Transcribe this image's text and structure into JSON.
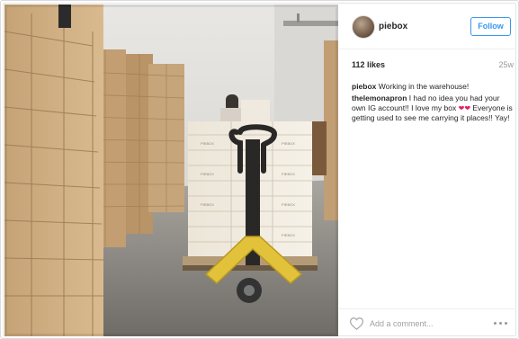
{
  "post": {
    "username": "piebox",
    "follow_label": "Follow",
    "likes": "112 likes",
    "time_ago": "25w",
    "caption_user": "piebox",
    "caption_text": "Working in the warehouse!",
    "comments": [
      {
        "user": "thelemonapron",
        "text_before": "I had no idea you had your own IG account!! I love my box",
        "emoji": "❤❤",
        "text_after": "Everyone is getting used to see me carrying it places!! Yay!"
      }
    ],
    "comment_placeholder": "Add a comment...",
    "photo": {
      "box_label": "PIEBOX"
    }
  },
  "icons": {
    "like": "heart-outline-icon",
    "more": "more-horizontal-icon"
  },
  "colors": {
    "accent": "#3897f0",
    "cardboard": "#c9a87f",
    "pallet_jack": "#e2c23a"
  }
}
